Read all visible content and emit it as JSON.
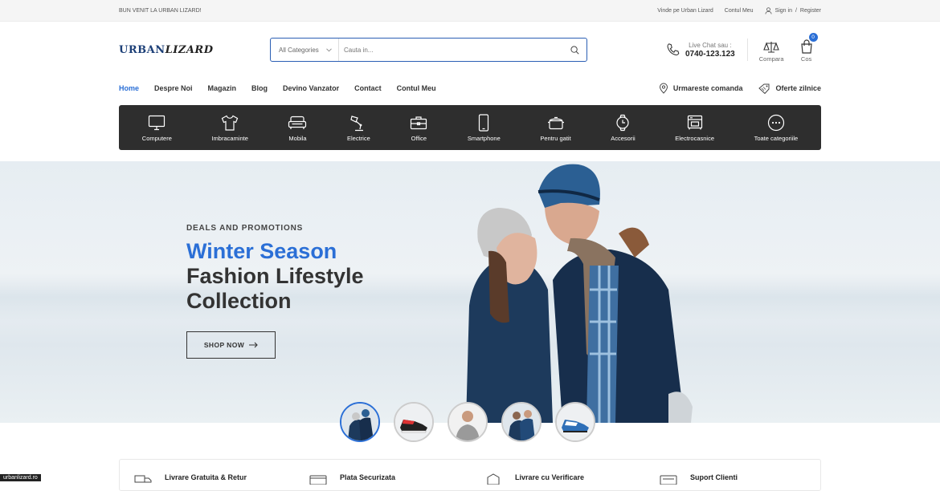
{
  "topbar": {
    "welcome": "BUN VENIT LA URBAN LIZARD!",
    "sell": "Vinde pe Urban Lizard",
    "account": "Contul Meu",
    "signin": "Sign in",
    "register": "Register"
  },
  "logo": {
    "part1": "URBAN",
    "part2": "LIZARD"
  },
  "search": {
    "category": "All Categories",
    "placeholder": "Cauta in..."
  },
  "contact": {
    "label": "Live Chat sau :",
    "phone": "0740-123.123"
  },
  "header_icons": {
    "compare": "Compara",
    "cart": "Cos",
    "cart_count": "0"
  },
  "nav": {
    "items": [
      "Home",
      "Despre Noi",
      "Magazin",
      "Blog",
      "Devino Vanzator",
      "Contact",
      "Contul Meu"
    ],
    "track": "Urmareste comanda",
    "offers": "Oferte zilnice"
  },
  "categories": [
    {
      "label": "Computere",
      "icon": "monitor-icon"
    },
    {
      "label": "Imbracaminte",
      "icon": "shirt-icon"
    },
    {
      "label": "Mobila",
      "icon": "sofa-icon"
    },
    {
      "label": "Electrice",
      "icon": "lamp-icon"
    },
    {
      "label": "Office",
      "icon": "briefcase-icon"
    },
    {
      "label": "Smartphone",
      "icon": "phone-icon"
    },
    {
      "label": "Pentru gatit",
      "icon": "pot-icon"
    },
    {
      "label": "Accesorii",
      "icon": "watch-icon"
    },
    {
      "label": "Electrocasnice",
      "icon": "appliance-icon"
    },
    {
      "label": "Toate categoriile",
      "icon": "more-icon"
    }
  ],
  "hero": {
    "eyebrow": "DEALS AND PROMOTIONS",
    "title": "Winter Season",
    "subtitle1": "Fashion Lifestyle",
    "subtitle2": "Collection",
    "cta": "SHOP NOW"
  },
  "features": [
    "Livrare Gratuita & Retur",
    "Plata Securizata",
    "Livrare cu Verificare",
    "Suport Clienti"
  ],
  "site_tag": "urbanlizard.ro",
  "colors": {
    "accent": "#2b6fd6",
    "dark": "#2e2e2e"
  }
}
